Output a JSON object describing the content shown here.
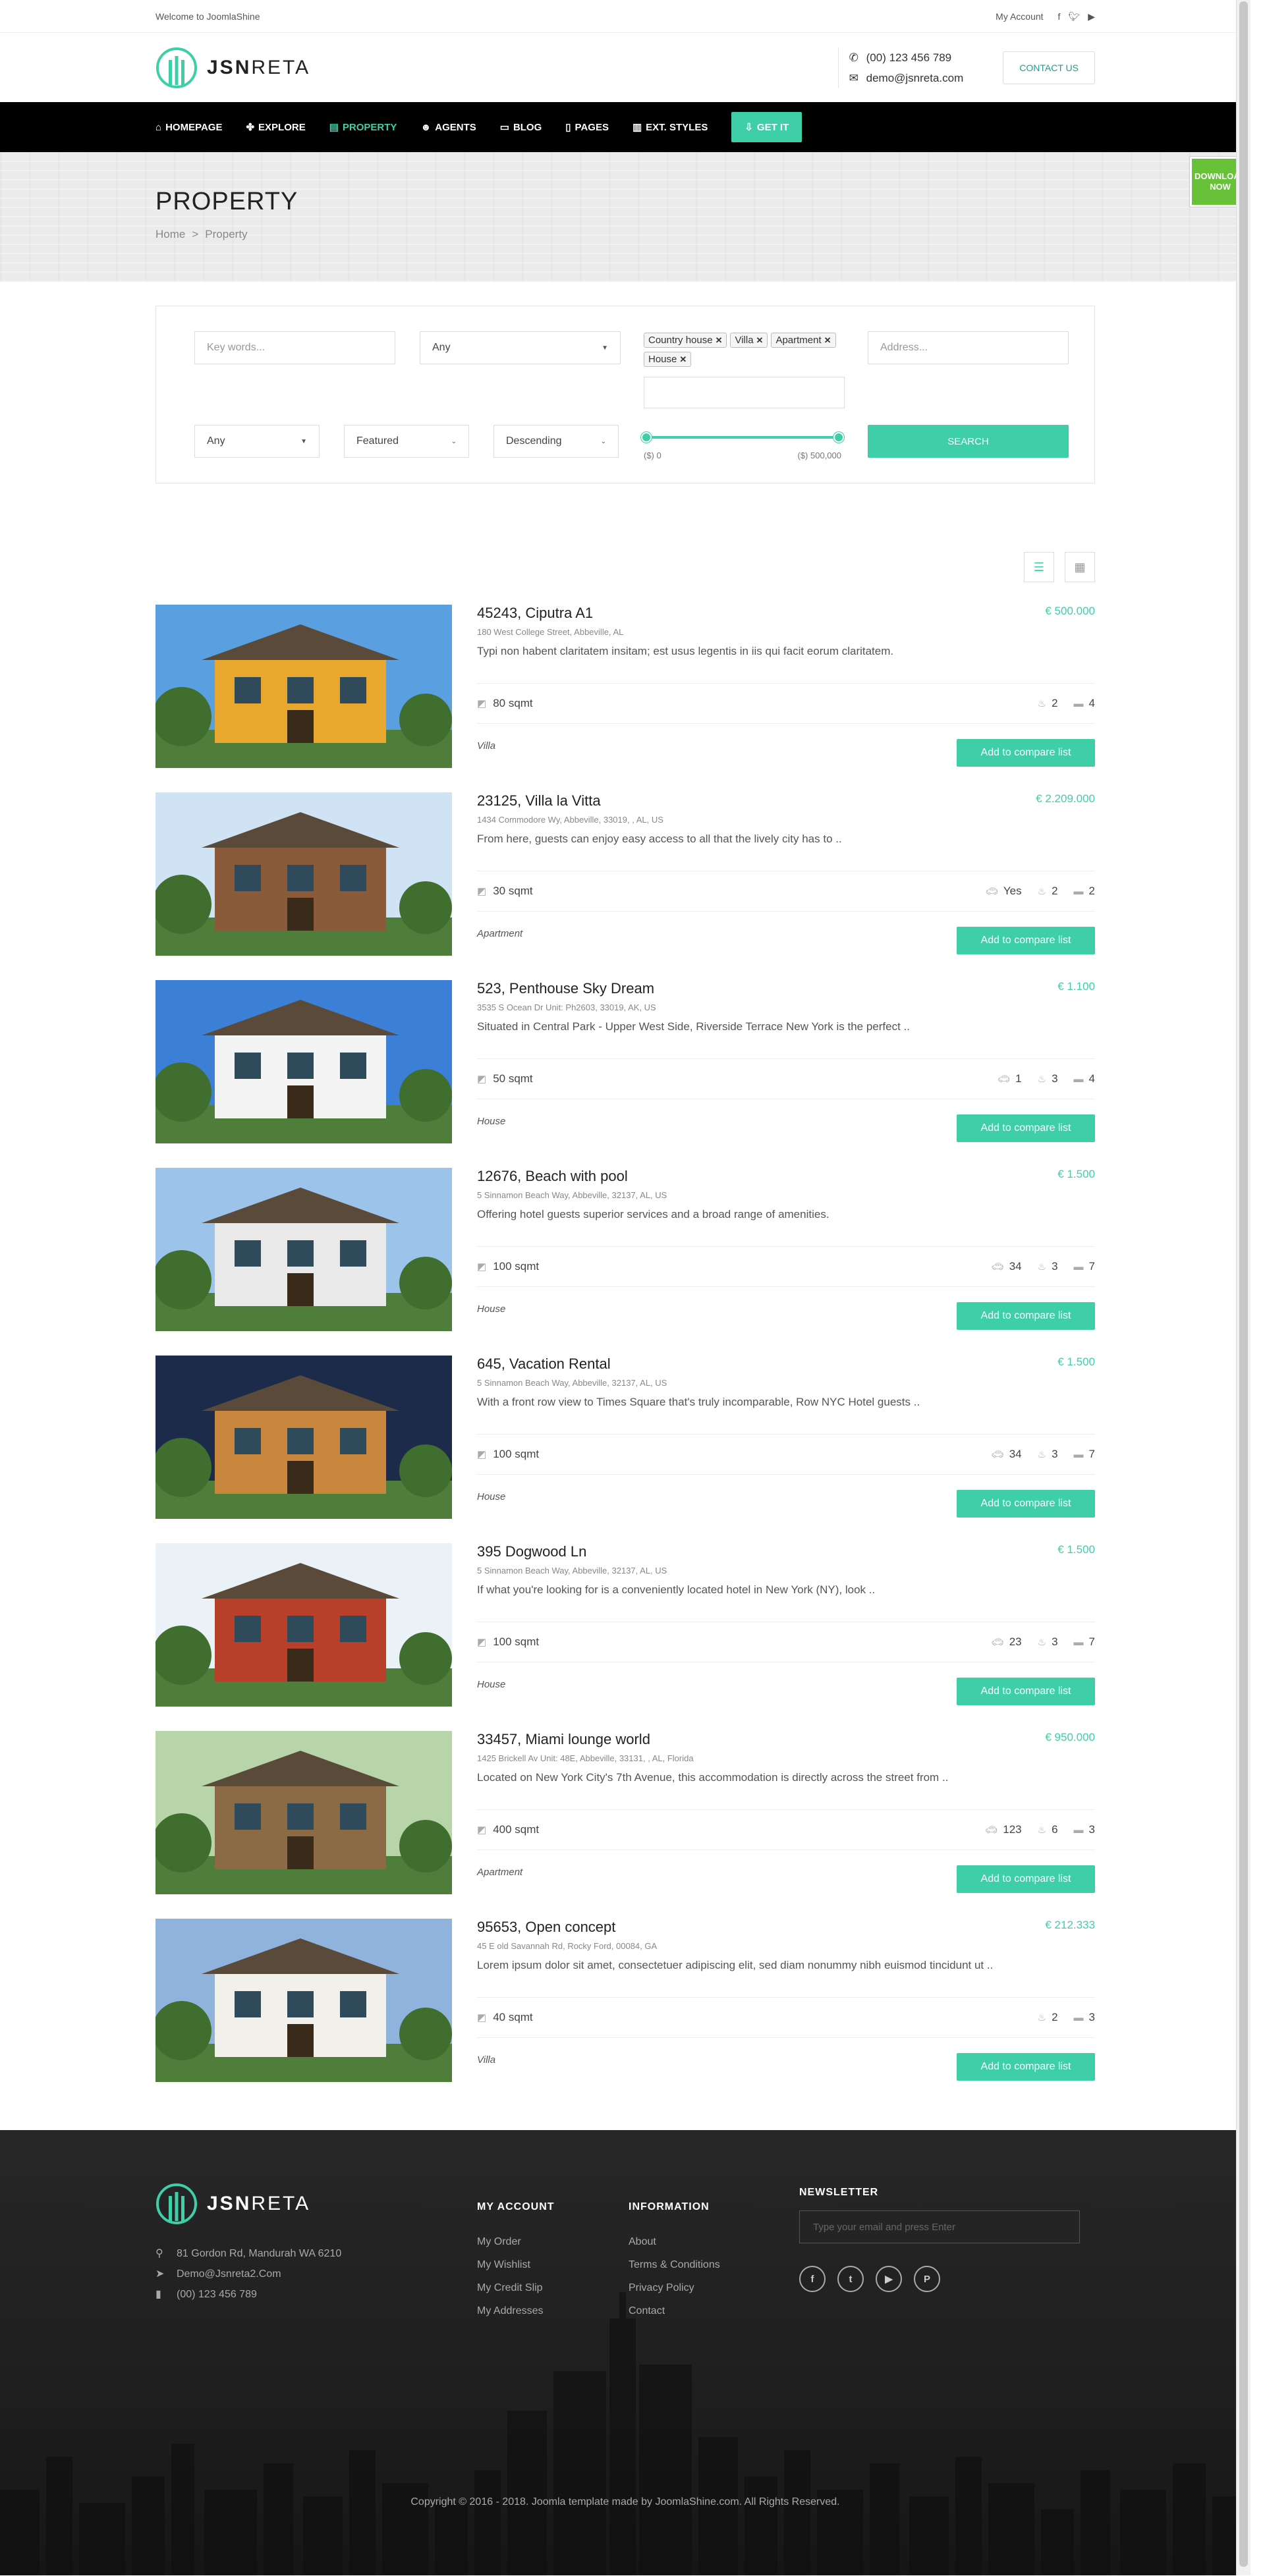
{
  "topbar": {
    "welcome": "Welcome to JoomlaShine",
    "account": "My Account"
  },
  "brand": {
    "bold": "JSN",
    "light": "RETA"
  },
  "header": {
    "phone": "(00) 123 456 789",
    "email": "demo@jsnreta.com",
    "contact_label": "CONTACT US"
  },
  "nav": [
    {
      "label": "HOMEPAGE",
      "icon": "⌂",
      "active": false
    },
    {
      "label": "EXPLORE",
      "icon": "✤",
      "active": false
    },
    {
      "label": "PROPERTY",
      "icon": "▤",
      "active": true
    },
    {
      "label": "AGENTS",
      "icon": "☻",
      "active": false
    },
    {
      "label": "BLOG",
      "icon": "▭",
      "active": false
    },
    {
      "label": "PAGES",
      "icon": "▯",
      "active": false
    },
    {
      "label": "EXT. STYLES",
      "icon": "▥",
      "active": false
    }
  ],
  "nav_get": "GET IT",
  "download": "DOWNLOAD NOW",
  "page": {
    "title": "PROPERTY",
    "crumb_home": "Home",
    "crumb_current": "Property"
  },
  "search": {
    "keywords_placeholder": "Key words...",
    "status": "Any",
    "tags": [
      "Country house",
      "Villa",
      "Apartment",
      "House"
    ],
    "address_placeholder": "Address...",
    "category": "Any",
    "order_by": "Featured",
    "direction": "Descending",
    "price_min": "($) 0",
    "price_max": "($) 500,000",
    "button": "SEARCH"
  },
  "listings": [
    {
      "title": "45243, Ciputra A1",
      "price": "€ 500.000",
      "address": "180 West College Street, Abbeville, AL",
      "desc": "Typi non habent claritatem insitam; est usus legentis in iis qui facit eorum claritatem.",
      "area": "80 sqmt",
      "garage": "",
      "bath": "2",
      "bed": "4",
      "type": "Villa",
      "button": "Add to compare list"
    },
    {
      "title": "23125, Villa la Vitta",
      "price": "€ 2.209.000",
      "address": "1434 Commodore Wy, Abbeville, 33019, , AL, US",
      "desc": "From here, guests can enjoy easy access to all that the lively city has to ..",
      "area": "30 sqmt",
      "garage": "Yes",
      "bath": "2",
      "bed": "2",
      "type": "Apartment",
      "button": "Add to compare list"
    },
    {
      "title": "523, Penthouse Sky Dream",
      "price": "€ 1.100",
      "address": "3535 S Ocean Dr Unit: Ph2603, 33019, AK, US",
      "desc": "Situated in Central Park - Upper West Side, Riverside Terrace New York is the perfect ..",
      "area": "50 sqmt",
      "garage": "1",
      "bath": "3",
      "bed": "4",
      "type": "House",
      "button": "Add to compare list"
    },
    {
      "title": "12676, Beach with pool",
      "price": "€ 1.500",
      "address": "5 Sinnamon Beach Way, Abbeville, 32137, AL, US",
      "desc": "Offering hotel guests superior services and a broad range of amenities.",
      "area": "100 sqmt",
      "garage": "34",
      "bath": "3",
      "bed": "7",
      "type": "House",
      "button": "Add to compare list"
    },
    {
      "title": "645, Vacation Rental",
      "price": "€ 1.500",
      "address": "5 Sinnamon Beach Way, Abbeville, 32137, AL, US",
      "desc": "With a front row view to Times Square that's truly incomparable, Row NYC Hotel guests ..",
      "area": "100 sqmt",
      "garage": "34",
      "bath": "3",
      "bed": "7",
      "type": "House",
      "button": "Add to compare list"
    },
    {
      "title": "395 Dogwood Ln",
      "price": "€ 1.500",
      "address": "5 Sinnamon Beach Way, Abbeville, 32137, AL, US",
      "desc": "If what you're looking for is a conveniently located hotel in New York (NY), look ..",
      "area": "100 sqmt",
      "garage": "23",
      "bath": "3",
      "bed": "7",
      "type": "House",
      "button": "Add to compare list"
    },
    {
      "title": "33457, Miami lounge world",
      "price": "€ 950.000",
      "address": "1425 Brickell Av Unit: 48E, Abbeville, 33131, , AL, Florida",
      "desc": "Located on New York City's 7th Avenue, this accommodation is directly across the street from ..",
      "area": "400 sqmt",
      "garage": "123",
      "bath": "6",
      "bed": "3",
      "type": "Apartment",
      "button": "Add to compare list"
    },
    {
      "title": "95653, Open concept",
      "price": "€ 212.333",
      "address": "45 E old Savannah Rd, Rocky Ford, 00084, GA",
      "desc": "Lorem ipsum dolor sit amet, consectetuer adipiscing elit, sed diam nonummy nibh euismod tincidunt ut ..",
      "area": "40 sqmt",
      "garage": "",
      "bath": "2",
      "bed": "3",
      "type": "Villa",
      "button": "Add to compare list"
    }
  ],
  "footer": {
    "address": "81 Gordon Rd, Mandurah WA 6210",
    "email": "Demo@Jsnreta2.Com",
    "phone": "(00) 123 456 789",
    "account_title": "MY ACCOUNT",
    "account_links": [
      "My Order",
      "My Wishlist",
      "My Credit Slip",
      "My Addresses"
    ],
    "info_title": "INFORMATION",
    "info_links": [
      "About",
      "Terms & Conditions",
      "Privacy Policy",
      "Contact"
    ],
    "newsletter_title": "NEWSLETTER",
    "newsletter_placeholder": "Type your email and press Enter",
    "copyright": "Copyright © 2016 - 2018. Joomla template made by JoomlaShine.com. All Rights Reserved."
  },
  "colors": {
    "accent": "#3ecfa8",
    "nav_bg": "#000000",
    "download_bg": "#67c23a",
    "footer_bg": "#222222"
  }
}
